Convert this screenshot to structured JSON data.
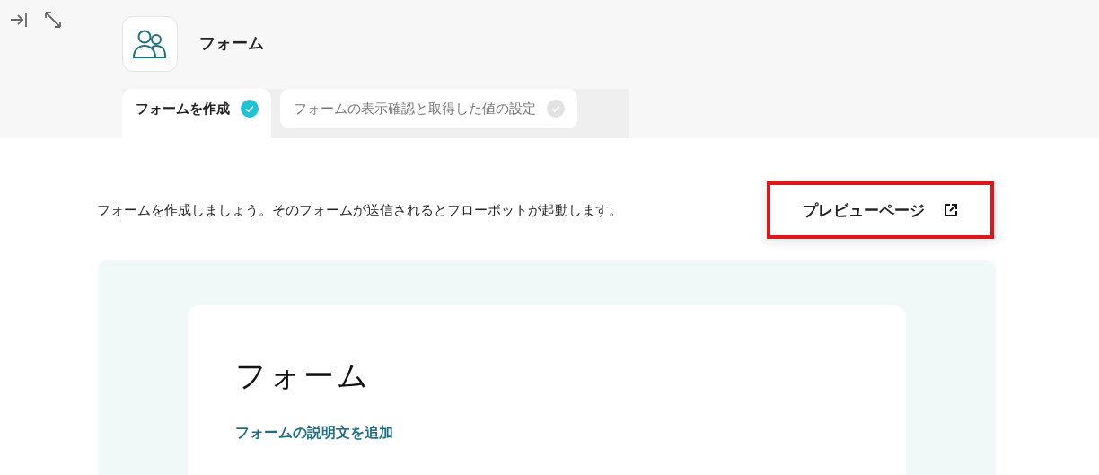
{
  "header": {
    "title": "フォーム"
  },
  "steps": [
    {
      "label": "フォームを作成",
      "selected": true,
      "completed": true
    },
    {
      "label": "フォームの表示確認と取得した値の設定",
      "selected": false,
      "completed": false
    }
  ],
  "description": "フォームを作成しましょう。そのフォームが送信されるとフローボットが起動します。",
  "preview_button": {
    "label": "プレビューページ",
    "highlighted": true
  },
  "form": {
    "title": "フォーム",
    "add_description_link": "フォームの説明文を追加"
  }
}
